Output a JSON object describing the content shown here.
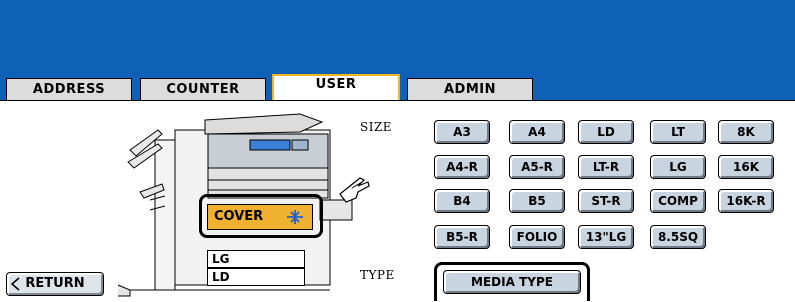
{
  "tabs": [
    {
      "label": "ADDRESS"
    },
    {
      "label": "COUNTER"
    },
    {
      "label": "USER"
    },
    {
      "label": "ADMIN"
    }
  ],
  "size_label": "SIZE",
  "type_label": "TYPE",
  "sizes": [
    "A3",
    "A4",
    "LD",
    "LT",
    "8K",
    "A4-R",
    "A5-R",
    "LT-R",
    "LG",
    "16K",
    "B4",
    "B5",
    "ST-R",
    "COMP",
    "16K-R",
    "B5-R",
    "FOLIO",
    "13\"LG",
    "8.5SQ"
  ],
  "media_type_label": "MEDIA TYPE",
  "return_label": "RETURN",
  "trays": {
    "cover": "COVER",
    "tray2": "LG",
    "tray3": "LD"
  },
  "colors": {
    "banner": "#0e61b6",
    "active_tab_border": "#f2b322",
    "button_face": "#c8d4e0",
    "cover_tray": "#f0b030"
  },
  "icons": {
    "return": "return-arrow-icon",
    "cover_size_change": "size-change-icon",
    "copier": "copier-illustration",
    "hand": "pointing-hand-icon"
  }
}
